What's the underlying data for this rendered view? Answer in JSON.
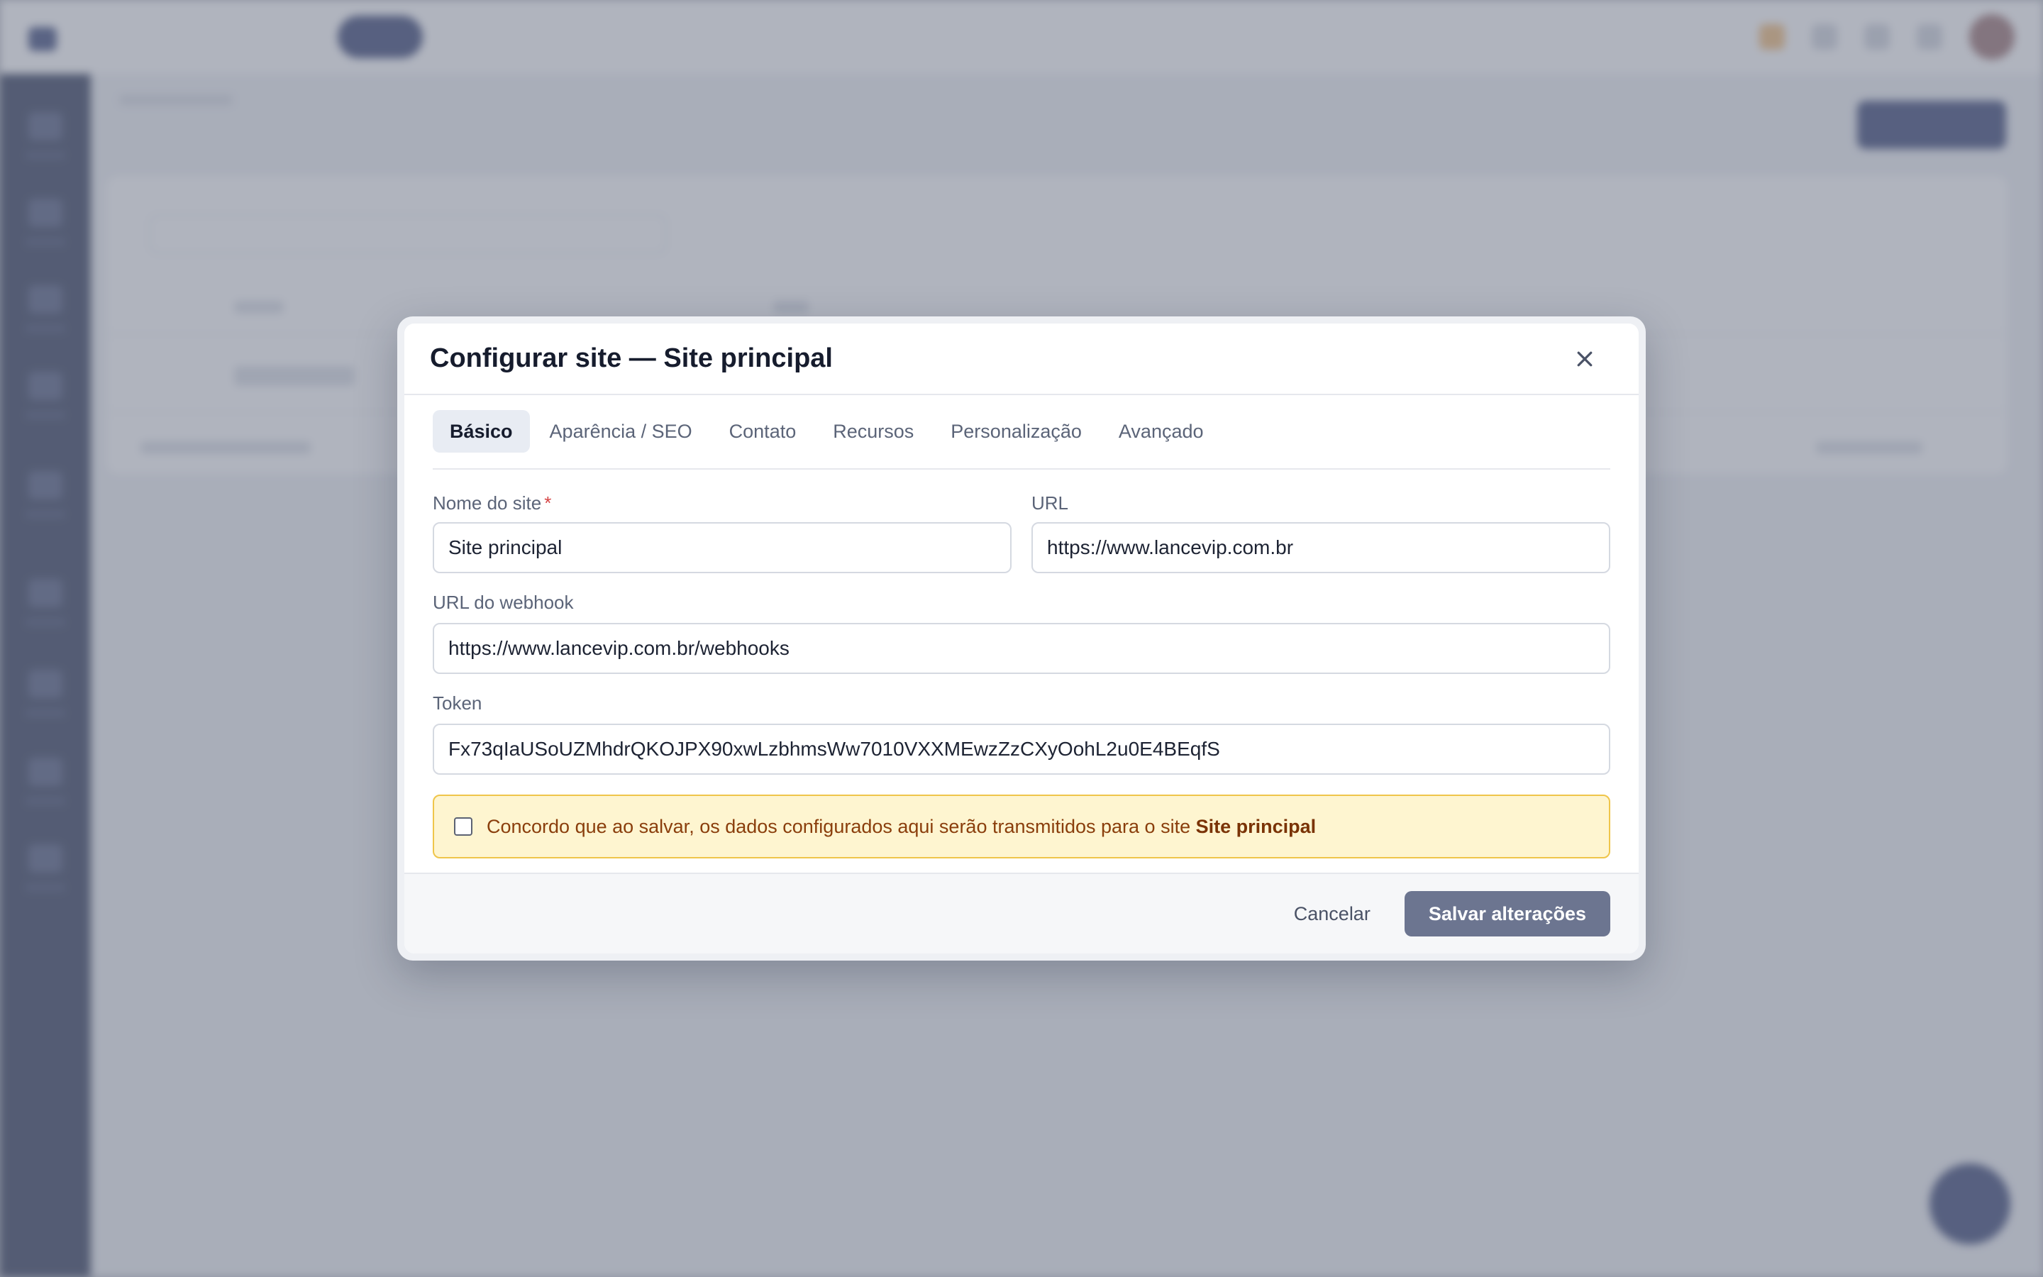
{
  "modal": {
    "title": "Configurar site — Site principal",
    "tabs": [
      {
        "label": "Básico"
      },
      {
        "label": "Aparência / SEO"
      },
      {
        "label": "Contato"
      },
      {
        "label": "Recursos"
      },
      {
        "label": "Personalização"
      },
      {
        "label": "Avançado"
      }
    ],
    "active_tab": "Básico",
    "fields": {
      "site_name": {
        "label": "Nome do site",
        "required_mark": "*",
        "value": "Site principal"
      },
      "url": {
        "label": "URL",
        "value": "https://www.lancevip.com.br"
      },
      "webhook_url": {
        "label": "URL do webhook",
        "value": "https://www.lancevip.com.br/webhooks"
      },
      "token": {
        "label": "Token",
        "value": "Fx73qIaUSoUZMhdrQKOJPX90xwLzbhmsWw7010VXXMEwzZzCXyOohL2u0E4BEqfS"
      }
    },
    "notice": {
      "text": "Concordo que ao salvar, os dados configurados aqui serão transmitidos para o site ",
      "strong": "Site principal",
      "checked": false
    },
    "footer": {
      "cancel_label": "Cancelar",
      "save_label": "Salvar alterações"
    }
  },
  "icons": {
    "close": "close-icon",
    "checkbox": "checkbox-icon"
  },
  "colors": {
    "notice_background": "#fef5d0",
    "notice_border": "#efc54a",
    "save_button": "#6c7590",
    "required": "#d64545"
  }
}
